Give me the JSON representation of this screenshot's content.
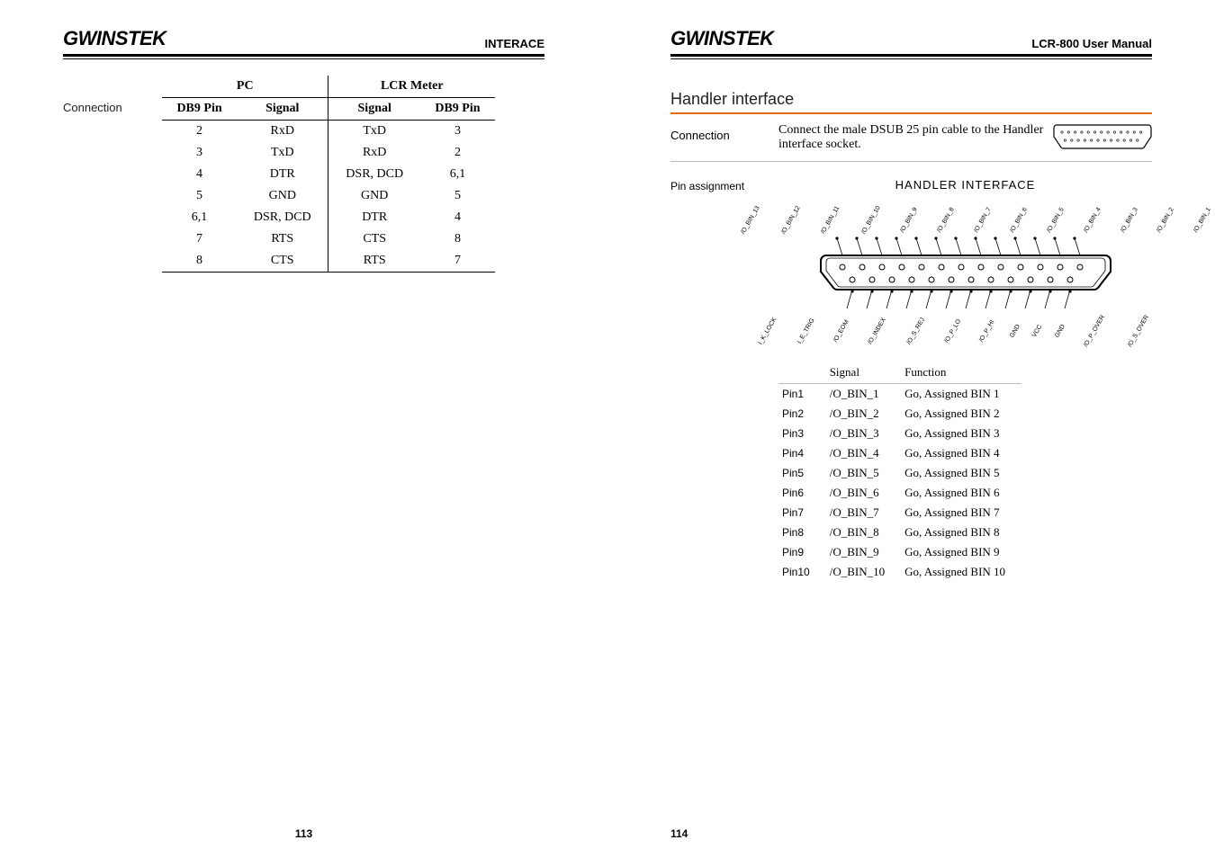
{
  "brand": "GWINSTEK",
  "left": {
    "header_right": "INTERACE",
    "row_label": "Connection",
    "group_headers": [
      "PC",
      "LCR Meter"
    ],
    "col_headers": [
      "DB9 Pin",
      "Signal",
      "Signal",
      "DB9 Pin"
    ],
    "rows": [
      [
        "2",
        "RxD",
        "TxD",
        "3"
      ],
      [
        "3",
        "TxD",
        "RxD",
        "2"
      ],
      [
        "4",
        "DTR",
        "DSR, DCD",
        "6,1"
      ],
      [
        "5",
        "GND",
        "GND",
        "5"
      ],
      [
        "6,1",
        "DSR, DCD",
        "DTR",
        "4"
      ],
      [
        "7",
        "RTS",
        "CTS",
        "8"
      ],
      [
        "8",
        "CTS",
        "RTS",
        "7"
      ]
    ],
    "page_num": "113"
  },
  "right": {
    "header_right": "LCR-800 User Manual",
    "section_title": "Handler interface",
    "conn_label": "Connection",
    "conn_text": "Connect the male DSUB 25 pin cable to the Handler interface socket.",
    "pa_label": "Pin assignment",
    "hi_title": "HANDLER  INTERFACE",
    "top_pins": [
      "/O_BIN_13",
      "/O_BIN_12",
      "/O_BIN_11",
      "/O_BIN_10",
      "/O_BIN_9",
      "/O_BIN_8",
      "/O_BIN_7",
      "/O_BIN_6",
      "/O_BIN_5",
      "/O_BIN_4",
      "/O_BIN_3",
      "/O_BIN_2",
      "/O_BIN_1"
    ],
    "bottom_pins": [
      "I_K_LOCK",
      "I_E_TRIG",
      "/O_EOM",
      "/O_INDEX",
      "/O_S_REJ",
      "/O_P_LO",
      "/O_P_HI",
      "GND",
      "VCC",
      "GND",
      "/O_P_OVER",
      "/O_S_OVER"
    ],
    "sig_headers": [
      "",
      "Signal",
      "Function"
    ],
    "sig_rows": [
      [
        "Pin1",
        "/O_BIN_1",
        "Go, Assigned BIN 1"
      ],
      [
        "Pin2",
        "/O_BIN_2",
        "Go, Assigned BIN 2"
      ],
      [
        "Pin3",
        "/O_BIN_3",
        "Go, Assigned BIN 3"
      ],
      [
        "Pin4",
        "/O_BIN_4",
        "Go, Assigned BIN 4"
      ],
      [
        "Pin5",
        "/O_BIN_5",
        "Go, Assigned BIN 5"
      ],
      [
        "Pin6",
        "/O_BIN_6",
        "Go, Assigned BIN 6"
      ],
      [
        "Pin7",
        "/O_BIN_7",
        "Go, Assigned BIN 7"
      ],
      [
        "Pin8",
        "/O_BIN_8",
        "Go, Assigned BIN 8"
      ],
      [
        "Pin9",
        "/O_BIN_9",
        "Go, Assigned BIN 9"
      ],
      [
        "Pin10",
        "/O_BIN_10",
        "Go, Assigned BIN 10"
      ]
    ],
    "page_num": "114"
  }
}
